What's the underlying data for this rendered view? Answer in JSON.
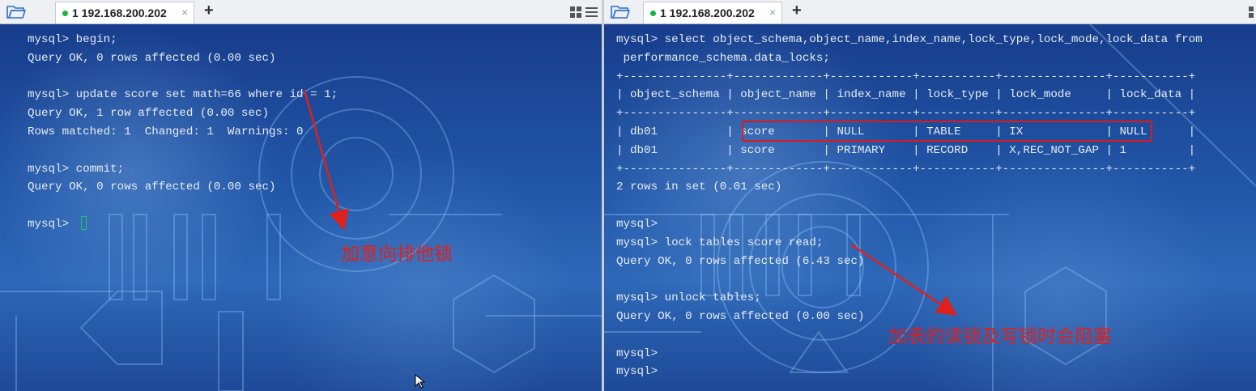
{
  "left": {
    "tab": {
      "title": "1 192.168.200.202",
      "close": "×",
      "add": "+"
    },
    "lines": [
      "mysql> begin;",
      "Query OK, 0 rows affected (0.00 sec)",
      "",
      "mysql> update score set math=66 where id = 1;",
      "Query OK, 1 row affected (0.00 sec)",
      "Rows matched: 1  Changed: 1  Warnings: 0",
      "",
      "mysql> commit;",
      "Query OK, 0 rows affected (0.00 sec)",
      "",
      "mysql> "
    ],
    "annotation": "加意向排他锁"
  },
  "right": {
    "tab": {
      "title": "1 192.168.200.202",
      "close": "×",
      "add": "+"
    },
    "lines": [
      "mysql> select object_schema,object_name,index_name,lock_type,lock_mode,lock_data from",
      " performance_schema.data_locks;",
      "+---------------+-------------+------------+-----------+---------------+-----------+",
      "| object_schema | object_name | index_name | lock_type | lock_mode     | lock_data |",
      "+---------------+-------------+------------+-----------+---------------+-----------+",
      "| db01          | score       | NULL       | TABLE     | IX            | NULL      |",
      "| db01          | score       | PRIMARY    | RECORD    | X,REC_NOT_GAP | 1         |",
      "+---------------+-------------+------------+-----------+---------------+-----------+",
      "2 rows in set (0.01 sec)",
      "",
      "mysql>",
      "mysql> lock tables score read;",
      "Query OK, 0 rows affected (6.43 sec)",
      "",
      "mysql> unlock tables;",
      "Query OK, 0 rows affected (0.00 sec)",
      "",
      "mysql>",
      "mysql>"
    ],
    "annotation": "加表的读锁及写锁时会阻塞"
  },
  "colors": {
    "annotation": "#e0201a",
    "terminal_text": "#e6ecf4",
    "status_dot": "#1bb33a",
    "cursor": "#27c36a"
  },
  "icons": [
    "folder-icon",
    "status-dot-icon",
    "close-tab-icon",
    "add-tab-icon",
    "layout-grid-icon",
    "menu-lines-icon",
    "mouse-pointer-icon"
  ]
}
